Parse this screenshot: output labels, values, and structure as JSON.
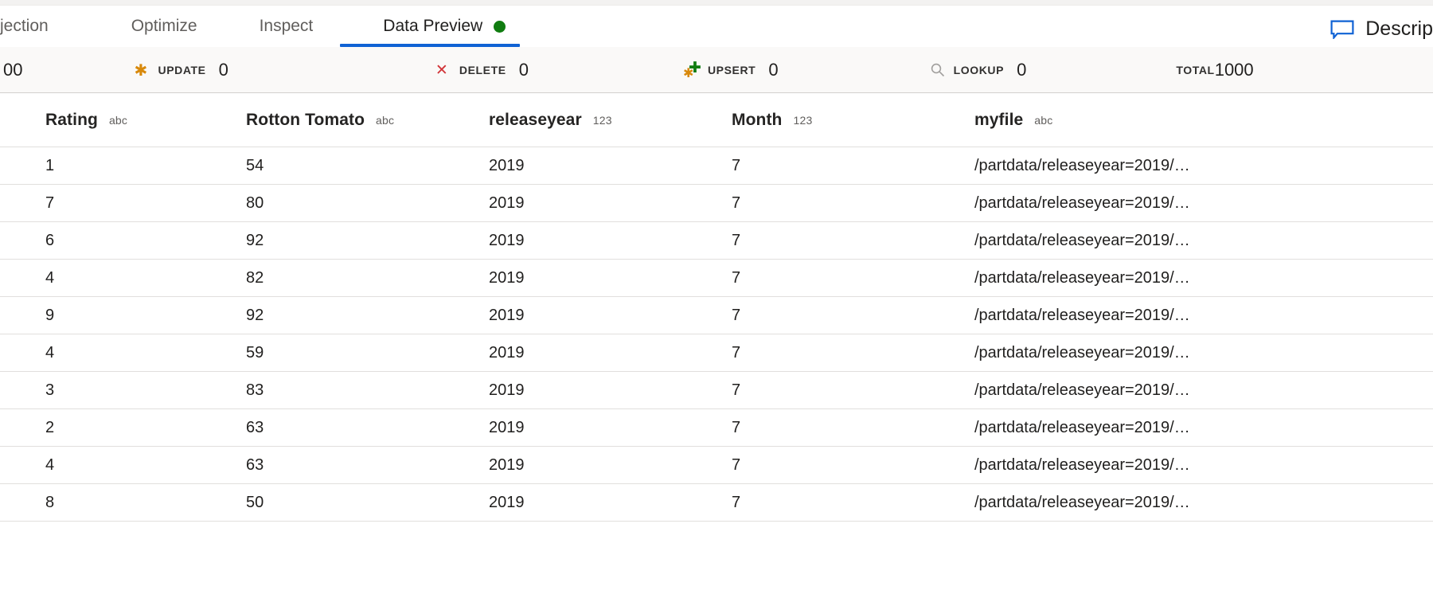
{
  "tabs": [
    {
      "label": "jection",
      "active": false,
      "clipped": true,
      "icon": null
    },
    {
      "label": "Optimize",
      "active": false,
      "clipped": false,
      "icon": null
    },
    {
      "label": "Inspect",
      "active": false,
      "clipped": false,
      "icon": null
    },
    {
      "label": "Data Preview",
      "active": true,
      "clipped": false,
      "icon": "status-dot-green"
    }
  ],
  "description_button": {
    "label": "Descrip",
    "icon": "comment-balloon-icon",
    "icon_color": "#0f62d4"
  },
  "stats": [
    {
      "name": "",
      "value": "00",
      "icon": null,
      "clipped": true
    },
    {
      "name": "UPDATE",
      "value": "0",
      "icon": "asterisk-icon"
    },
    {
      "name": "DELETE",
      "value": "0",
      "icon": "x-icon"
    },
    {
      "name": "UPSERT",
      "value": "0",
      "icon": "asterisk-plus-icon"
    },
    {
      "name": "LOOKUP",
      "value": "0",
      "icon": "search-icon"
    },
    {
      "name": "TOTAL",
      "value": "1000",
      "icon": null
    }
  ],
  "table": {
    "columns": [
      {
        "name": "Rating",
        "type": "abc"
      },
      {
        "name": "Rotton Tomato",
        "type": "abc"
      },
      {
        "name": "releaseyear",
        "type": "123"
      },
      {
        "name": "Month",
        "type": "123"
      },
      {
        "name": "myfile",
        "type": "abc"
      }
    ],
    "rows": [
      {
        "Rating": "1",
        "RottonTomato": "54",
        "releaseyear": "2019",
        "Month": "7",
        "myfile": "/partdata/releaseyear=2019/…"
      },
      {
        "Rating": "7",
        "RottonTomato": "80",
        "releaseyear": "2019",
        "Month": "7",
        "myfile": "/partdata/releaseyear=2019/…"
      },
      {
        "Rating": "6",
        "RottonTomato": "92",
        "releaseyear": "2019",
        "Month": "7",
        "myfile": "/partdata/releaseyear=2019/…"
      },
      {
        "Rating": "4",
        "RottonTomato": "82",
        "releaseyear": "2019",
        "Month": "7",
        "myfile": "/partdata/releaseyear=2019/…"
      },
      {
        "Rating": "9",
        "RottonTomato": "92",
        "releaseyear": "2019",
        "Month": "7",
        "myfile": "/partdata/releaseyear=2019/…"
      },
      {
        "Rating": "4",
        "RottonTomato": "59",
        "releaseyear": "2019",
        "Month": "7",
        "myfile": "/partdata/releaseyear=2019/…"
      },
      {
        "Rating": "3",
        "RottonTomato": "83",
        "releaseyear": "2019",
        "Month": "7",
        "myfile": "/partdata/releaseyear=2019/…"
      },
      {
        "Rating": "2",
        "RottonTomato": "63",
        "releaseyear": "2019",
        "Month": "7",
        "myfile": "/partdata/releaseyear=2019/…"
      },
      {
        "Rating": "4",
        "RottonTomato": "63",
        "releaseyear": "2019",
        "Month": "7",
        "myfile": "/partdata/releaseyear=2019/…"
      },
      {
        "Rating": "8",
        "RottonTomato": "50",
        "releaseyear": "2019",
        "Month": "7",
        "myfile": "/partdata/releaseyear=2019/…"
      }
    ]
  },
  "colors": {
    "accent": "#0f62d4",
    "status_green": "#107c10",
    "update_orange": "#d8890b",
    "delete_red": "#d13438",
    "stats_bg": "#faf9f8"
  }
}
